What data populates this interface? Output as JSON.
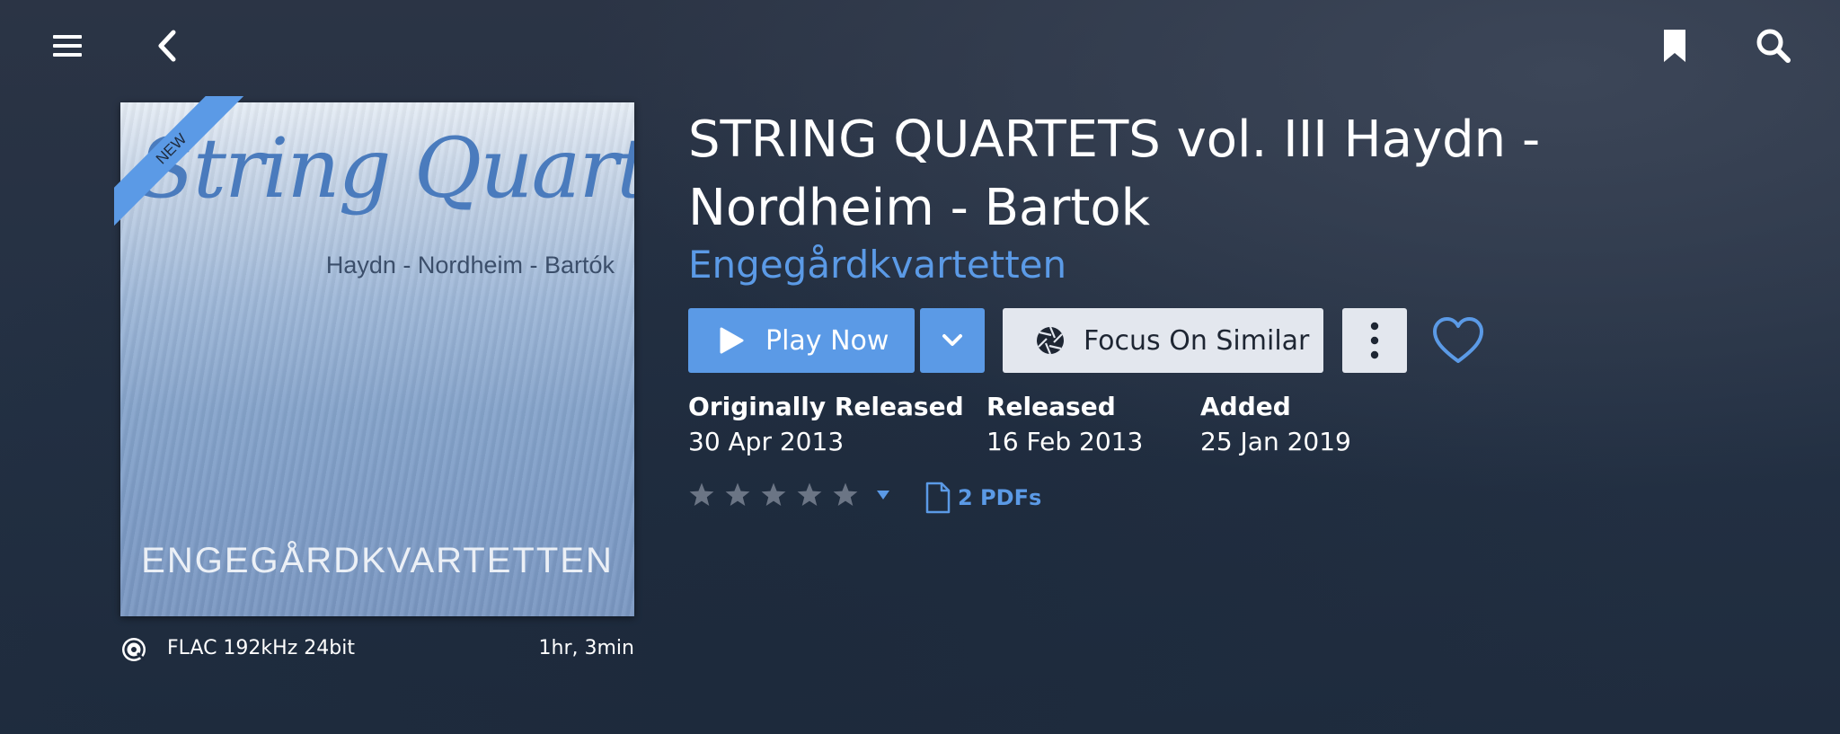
{
  "topbar": {
    "menu_icon": "hamburger-menu-icon",
    "back_icon": "chevron-left-icon",
    "bookmark_icon": "bookmark-icon",
    "search_icon": "search-icon"
  },
  "album": {
    "cover": {
      "badge": "NEW",
      "title_art": "String Quartets",
      "composers_art": "Haydn - Nordheim - Bartók",
      "artist_art": "ENGEGÅRDKVARTETTEN"
    },
    "format": "FLAC 192kHz 24bit",
    "duration": "1hr, 3min",
    "title": "STRING QUARTETS vol. III  Haydn - Nordheim - Bartok",
    "artist": "Engegårdkvartetten"
  },
  "actions": {
    "play_label": "Play Now",
    "focus_label": "Focus On Similar"
  },
  "meta": [
    {
      "label": "Originally Released",
      "value": "30 Apr 2013"
    },
    {
      "label": "Released",
      "value": "16 Feb 2013"
    },
    {
      "label": "Added",
      "value": "25 Jan 2019"
    }
  ],
  "rating": {
    "stars": 0,
    "max": 5
  },
  "pdfs": {
    "label": "2 PDFs"
  },
  "colors": {
    "accent": "#5b9ae6",
    "background": "#253044",
    "button_light": "#e3e7ee",
    "star_inactive": "#6b7585"
  }
}
